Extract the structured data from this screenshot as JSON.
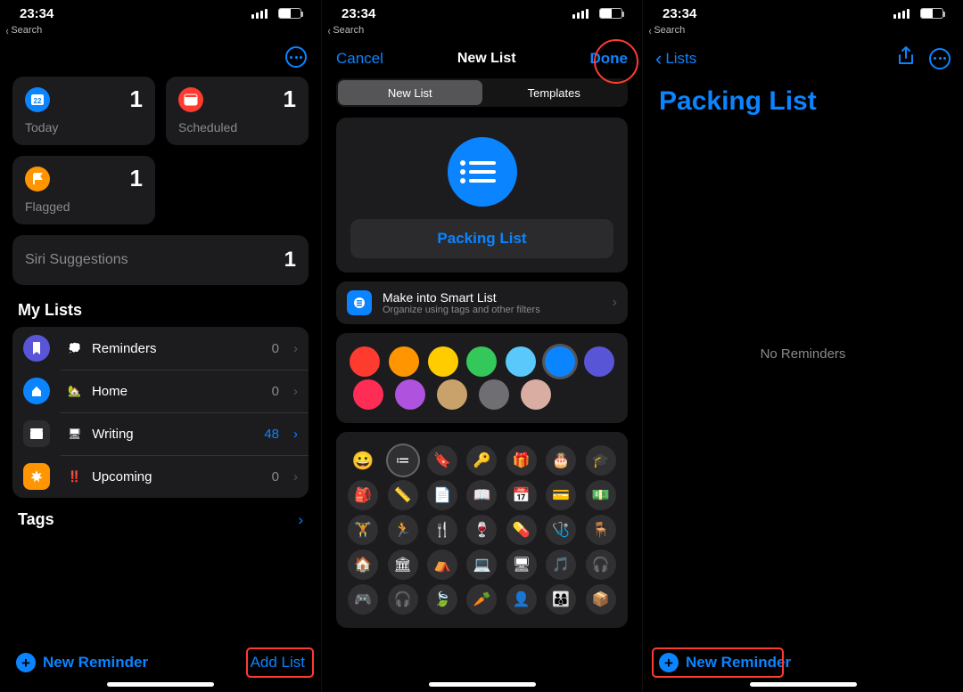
{
  "status": {
    "time": "23:34"
  },
  "back_search": "Search",
  "screen1": {
    "tiles": {
      "today": {
        "label": "Today",
        "count": "1"
      },
      "scheduled": {
        "label": "Scheduled",
        "count": "1"
      },
      "flagged": {
        "label": "Flagged",
        "count": "1"
      }
    },
    "siri_row": {
      "label": "Siri Suggestions",
      "count": "1"
    },
    "section_my_lists": "My Lists",
    "lists": [
      {
        "icon": "💭",
        "name": "Reminders",
        "count": "0",
        "hl": false,
        "icon_bg": "ic-rem"
      },
      {
        "icon": "🏡",
        "name": "Home",
        "count": "0",
        "hl": false,
        "icon_bg": "ic-home"
      },
      {
        "icon": "🖥",
        "name": "Writing",
        "count": "48",
        "hl": true,
        "icon_bg": "ic-write"
      },
      {
        "icon": "‼️",
        "name": "Upcoming",
        "count": "0",
        "hl": false,
        "icon_bg": "ic-upc"
      }
    ],
    "tags_label": "Tags",
    "new_reminder": "New Reminder",
    "add_list": "Add List"
  },
  "screen2": {
    "cancel": "Cancel",
    "title": "New List",
    "done": "Done",
    "seg_new": "New List",
    "seg_templates": "Templates",
    "list_name": "Packing List",
    "smart_title": "Make into Smart List",
    "smart_sub": "Organize using tags and other filters",
    "colors_selected_index": 5,
    "icons": [
      [
        "😀",
        "≔",
        "🔖",
        "🔑",
        "🎁",
        "🎂",
        "🎓"
      ],
      [
        "🎒",
        "📏",
        "📄",
        "📖",
        "📅",
        "💳",
        "💵"
      ],
      [
        "🏋",
        "🏃",
        "🍴",
        "🍷",
        "💊",
        "🩺",
        "🪑"
      ],
      [
        "🏠",
        "🏛",
        "⛺",
        "💻",
        "🖥",
        "🎵",
        "🎧"
      ],
      [
        "🎮",
        "🎧",
        "🍃",
        "🥕",
        "👤",
        "👨‍👩‍👦",
        "📦"
      ]
    ],
    "icon_selected": [
      0,
      1
    ]
  },
  "screen3": {
    "back_label": "Lists",
    "title": "Packing List",
    "empty": "No Reminders",
    "new_reminder": "New Reminder"
  }
}
